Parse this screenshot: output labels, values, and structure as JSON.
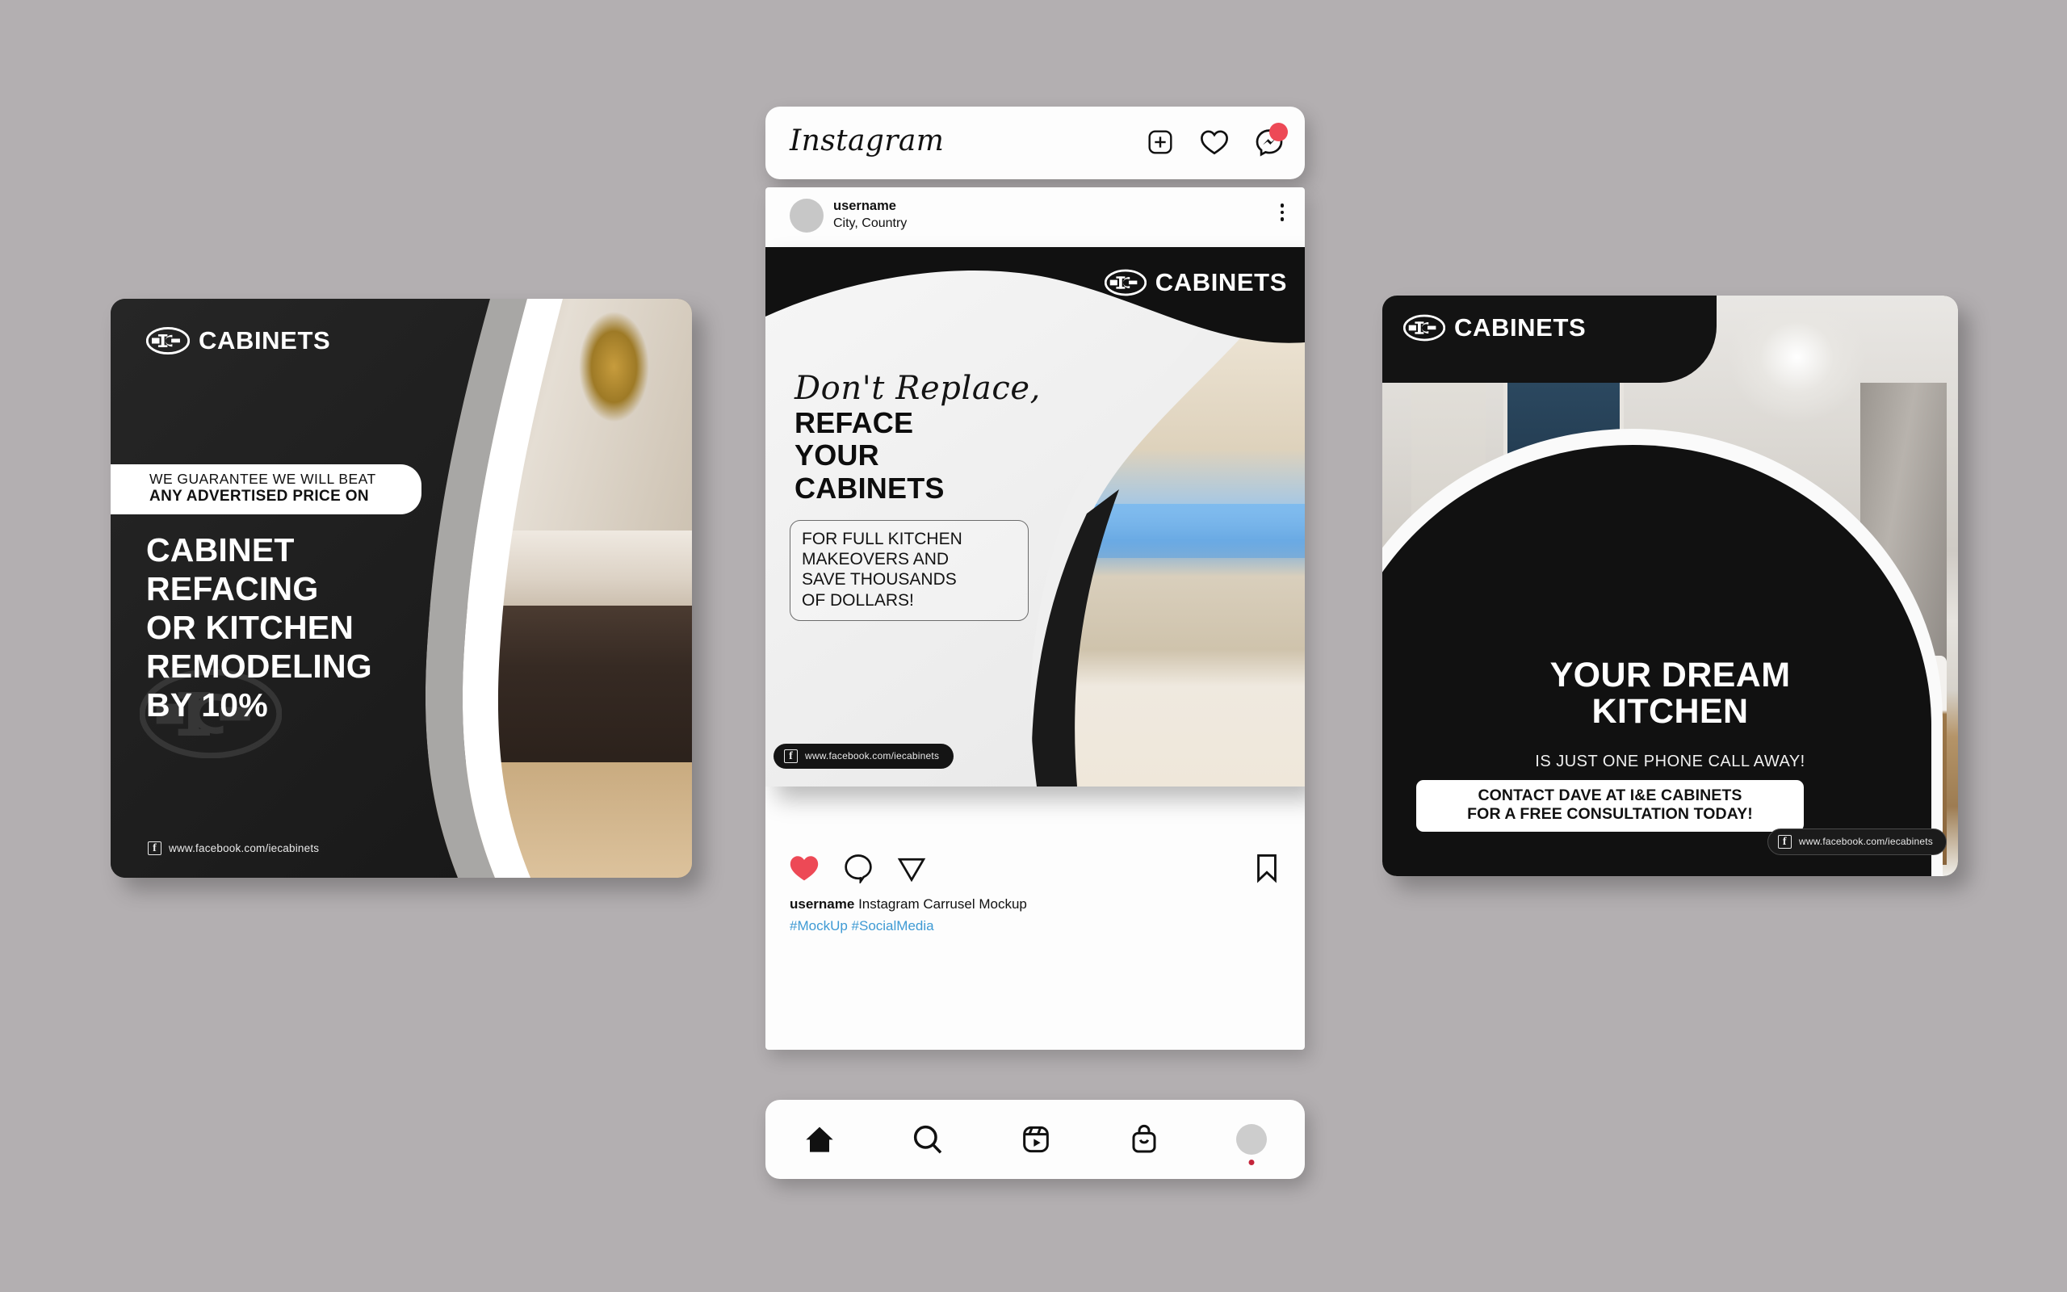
{
  "background_color": "#b3afb1",
  "brand": {
    "logo_text": "CABINETS",
    "logo_mark": "ie-oval-logo-icon",
    "facebook_url": "www.facebook.com/iecabinets",
    "facebook_icon": "facebook-icon"
  },
  "instagram": {
    "wordmark": "Instagram",
    "header_icons": [
      {
        "name": "new-post-icon",
        "label": "New post"
      },
      {
        "name": "activity-heart-icon",
        "label": "Activity"
      },
      {
        "name": "messenger-icon",
        "label": "Messages",
        "badge": true,
        "badge_color": "#ed4956"
      }
    ],
    "post": {
      "username": "username",
      "location": "City, Country",
      "more_options": "more-options-icon",
      "actions": [
        {
          "name": "like-icon",
          "label": "Like",
          "state": "liked",
          "color": "#ed4956"
        },
        {
          "name": "comment-icon",
          "label": "Comment"
        },
        {
          "name": "share-icon",
          "label": "Share"
        }
      ],
      "save_action": {
        "name": "bookmark-icon",
        "label": "Save"
      },
      "caption_username": "username",
      "caption_text": "Instagram Carrusel Mockup",
      "hashtags": "#MockUp #SocialMedia",
      "hashtag_color": "#3e9ad4"
    },
    "nav": [
      {
        "name": "home-icon",
        "label": "Home",
        "active": true
      },
      {
        "name": "search-icon",
        "label": "Search"
      },
      {
        "name": "reels-icon",
        "label": "Reels"
      },
      {
        "name": "shop-bag-icon",
        "label": "Shop"
      },
      {
        "name": "profile-avatar",
        "label": "Profile",
        "dot": true
      }
    ]
  },
  "slides": [
    {
      "id": "slide-left",
      "badge_line1": "WE GUARANTEE WE WILL BEAT",
      "badge_line2": "ANY ADVERTISED PRICE ON",
      "headline": "CABINET\nREFACING\nOR KITCHEN\nREMODELING\nBY 10%",
      "facebook_url": "www.facebook.com/iecabinets"
    },
    {
      "id": "slide-middle",
      "script_text": "Don't Replace,",
      "headline": "REFACE\nYOUR\nCABINETS",
      "subtext": "FOR FULL KITCHEN\nMAKEOVERS AND\nSAVE THOUSANDS\nOF DOLLARS!",
      "facebook_url": "www.facebook.com/iecabinets"
    },
    {
      "id": "slide-right",
      "headline": "YOUR DREAM\nKITCHEN",
      "subline": "IS JUST ONE PHONE CALL AWAY!",
      "cta": "CONTACT DAVE AT I&E CABINETS\nFOR A FREE CONSULTATION TODAY!",
      "facebook_url": "www.facebook.com/iecabinets"
    }
  ]
}
